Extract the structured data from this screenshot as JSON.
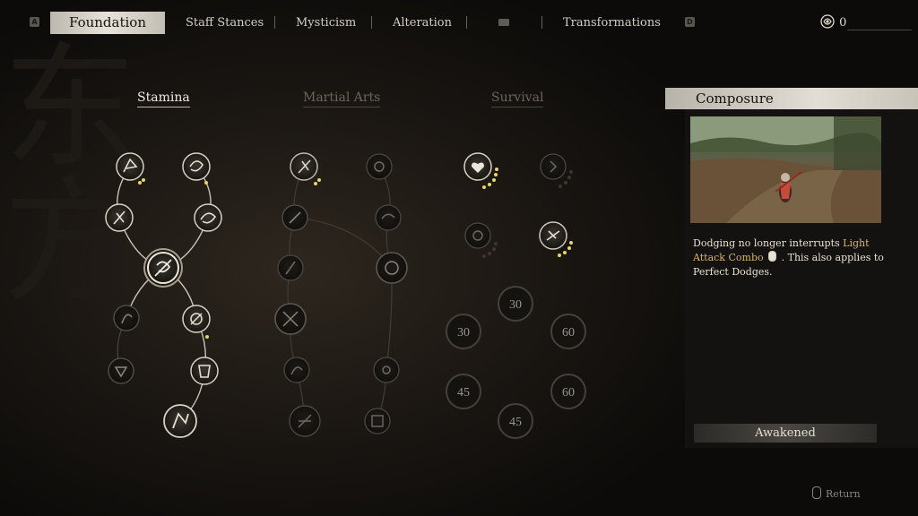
{
  "tabs": {
    "key_left": "A",
    "key_right": "D",
    "items": [
      {
        "label": "Foundation",
        "active": true
      },
      {
        "label": "Staff Stances"
      },
      {
        "label": "Mysticism"
      },
      {
        "label": "Alteration"
      },
      {
        "label": "Transformations"
      }
    ],
    "mail_icon": "mail-icon"
  },
  "currency": {
    "icon": "spark-swirl-icon",
    "value": "0"
  },
  "columns": [
    {
      "label": "Stamina",
      "active": true
    },
    {
      "label": "Martial Arts",
      "active": false
    },
    {
      "label": "Survival",
      "active": false
    }
  ],
  "survival_costs": [
    "30",
    "30",
    "60",
    "45",
    "60",
    "45"
  ],
  "detail": {
    "title": "Composure",
    "desc_1": "Dodging no longer interrupts ",
    "highlight": "Light Attack Combo",
    "desc_2": ". This also applies to Perfect Dodges.",
    "status": "Awakened"
  },
  "footer": {
    "return_label": "Return"
  },
  "colors": {
    "accent": "#d9b46a",
    "pip": "#e9d268",
    "active_tab": "#e6e2da"
  }
}
